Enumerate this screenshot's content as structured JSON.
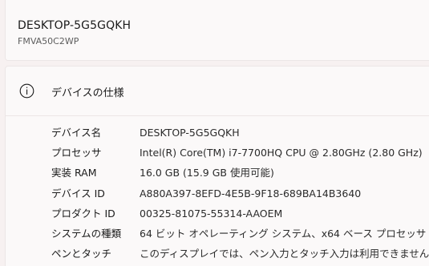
{
  "device": {
    "name": "DESKTOP-5G5GQKH",
    "model": "FMVA50C2WP"
  },
  "specs": {
    "title": "デバイスの仕様",
    "icon": "info-icon",
    "rows": [
      {
        "label": "デバイス名",
        "value": "DESKTOP-5G5GQKH"
      },
      {
        "label": "プロセッサ",
        "value": "Intel(R) Core(TM) i7-7700HQ CPU @ 2.80GHz (2.80 GHz)"
      },
      {
        "label": "実装 RAM",
        "value": "16.0 GB (15.9 GB 使用可能)"
      },
      {
        "label": "デバイス ID",
        "value": "A880A397-8EFD-4E5B-9F18-689BA14B3640"
      },
      {
        "label": "プロダクト ID",
        "value": "00325-81075-55314-AAOEM"
      },
      {
        "label": "システムの種類",
        "value": "64 ビット オペレーティング システム、x64 ベース プロセッサ"
      },
      {
        "label": "ペンとタッチ",
        "value": "このディスプレイでは、ペン入力とタッチ入力は利用できません"
      }
    ]
  }
}
